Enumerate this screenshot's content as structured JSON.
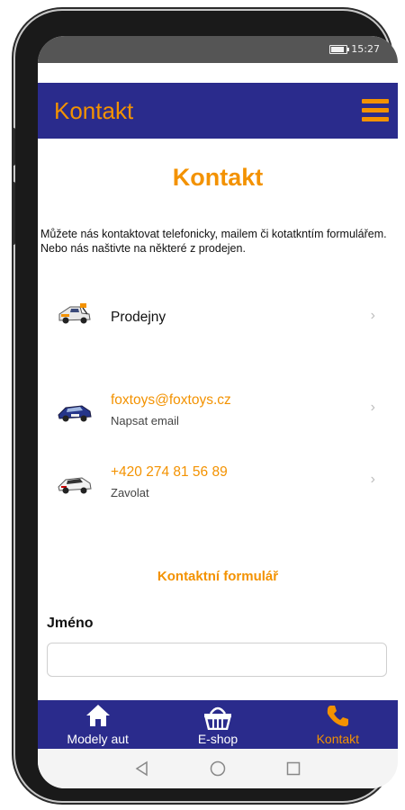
{
  "status_bar": {
    "time": "15:27"
  },
  "app_bar": {
    "title": "Kontakt",
    "menu_icon": "hamburger-menu-icon"
  },
  "page": {
    "title": "Kontakt",
    "intro": "Můžete nás kontaktovat telefonicky, mailem či kotatkntím formulářem. Nebo nás naštivte na některé z prodejen."
  },
  "contact_items": [
    {
      "title": "Prodejny",
      "subtitle": ""
    },
    {
      "title": "foxtoys@foxtoys.cz",
      "subtitle": "Napsat email"
    },
    {
      "title": "+420 274 81 56 89",
      "subtitle": "Zavolat"
    }
  ],
  "chevron": "›",
  "form": {
    "heading": "Kontaktní formulář",
    "name_label": "Jméno",
    "name_value": ""
  },
  "bottom_nav": [
    {
      "label": "Modely aut",
      "icon": "home-icon"
    },
    {
      "label": "E-shop",
      "icon": "basket-icon"
    },
    {
      "label": "Kontakt",
      "icon": "phone-icon"
    }
  ],
  "colors": {
    "accent": "#f39200",
    "bar": "#2a2b8c"
  }
}
